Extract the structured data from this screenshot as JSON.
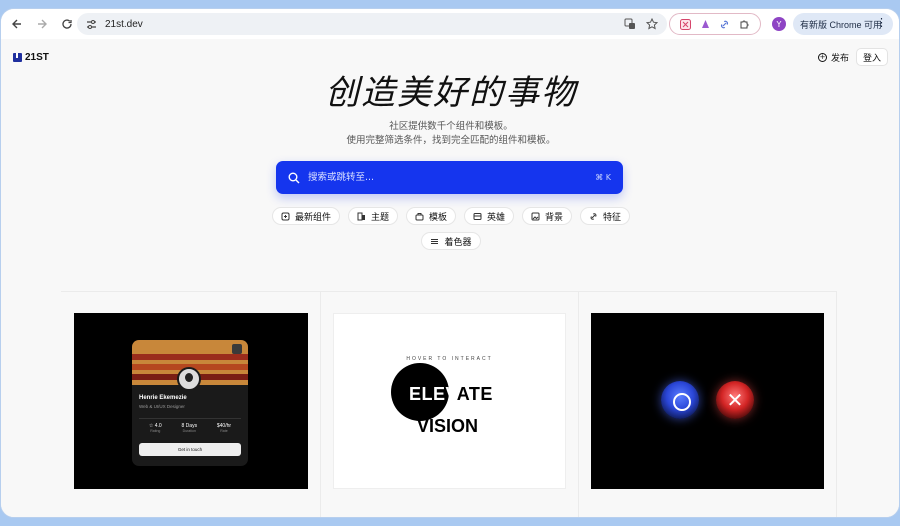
{
  "browser": {
    "url": "21st.dev",
    "update_label": "有新版 Chrome 可用",
    "profile_initial": "Y"
  },
  "header": {
    "logo": "21ST",
    "publish_label": "发布",
    "login_label": "登入"
  },
  "hero": {
    "title": "创造美好的事物",
    "subtitle_line1": "社区提供数千个组件和模板。",
    "subtitle_line2": "使用完整筛选条件，找到完全匹配的组件和模板。"
  },
  "search": {
    "placeholder": "搜索或跳转至...",
    "shortcut": "⌘ K"
  },
  "chips": [
    {
      "label": "最新组件",
      "icon": "new-icon"
    },
    {
      "label": "主题",
      "icon": "theme-icon"
    },
    {
      "label": "模板",
      "icon": "template-icon"
    },
    {
      "label": "英雄",
      "icon": "hero-icon"
    },
    {
      "label": "背景",
      "icon": "image-icon"
    },
    {
      "label": "特征",
      "icon": "link-icon"
    }
  ],
  "chips_row2": [
    {
      "label": "着色器",
      "icon": "shader-icon"
    }
  ],
  "cards": {
    "profile": {
      "name": "Henrie Ekemezie",
      "role": "Web & UI/UX Designer",
      "stats": [
        {
          "value": "☆ 4.0",
          "label": "Rating"
        },
        {
          "value": "8 Days",
          "label": "Duration"
        },
        {
          "value": "$40/hr",
          "label": "Rate"
        }
      ],
      "button": "Get in touch"
    },
    "elevate": {
      "hover_label": "HOVER TO INTERACT",
      "line1_white": "ELEV",
      "line1_black": "ATE",
      "line2": "VISION"
    }
  },
  "colors": {
    "accent": "#1535ee",
    "background": "#f8f8f8"
  }
}
